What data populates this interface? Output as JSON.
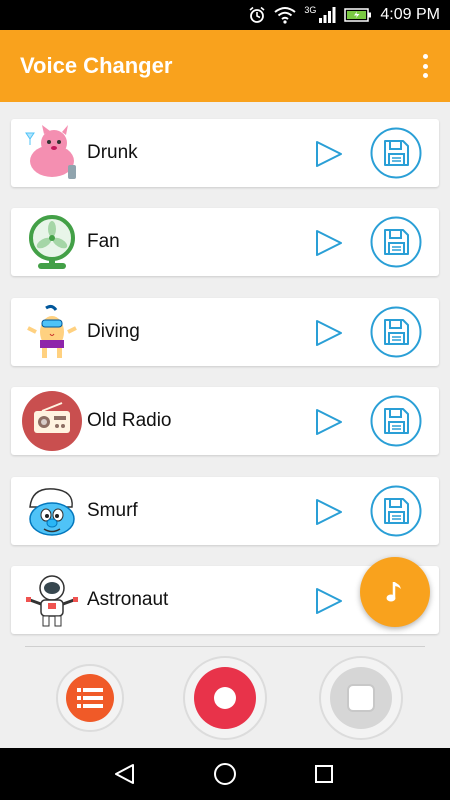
{
  "status_bar": {
    "time": "4:09 PM",
    "network": "3G"
  },
  "app_bar": {
    "title": "Voice Changer"
  },
  "effects": [
    {
      "name": "Drunk"
    },
    {
      "name": "Fan"
    },
    {
      "name": "Diving"
    },
    {
      "name": "Old Radio"
    },
    {
      "name": "Smurf"
    },
    {
      "name": "Astronaut"
    }
  ],
  "icons": {
    "menu": "more-vert-icon",
    "play": "play-outline-icon",
    "save": "floppy-disk-icon",
    "fab": "music-note-icon",
    "list": "list-icon",
    "record": "record-icon",
    "stop": "stop-icon",
    "back": "back-triangle-icon",
    "home": "home-circle-icon",
    "recents": "recents-square-icon"
  },
  "colors": {
    "accent": "#f9a21d",
    "icon_blue": "#2a9fd6",
    "record_red": "#e8334a",
    "list_orange": "#f05a28"
  }
}
